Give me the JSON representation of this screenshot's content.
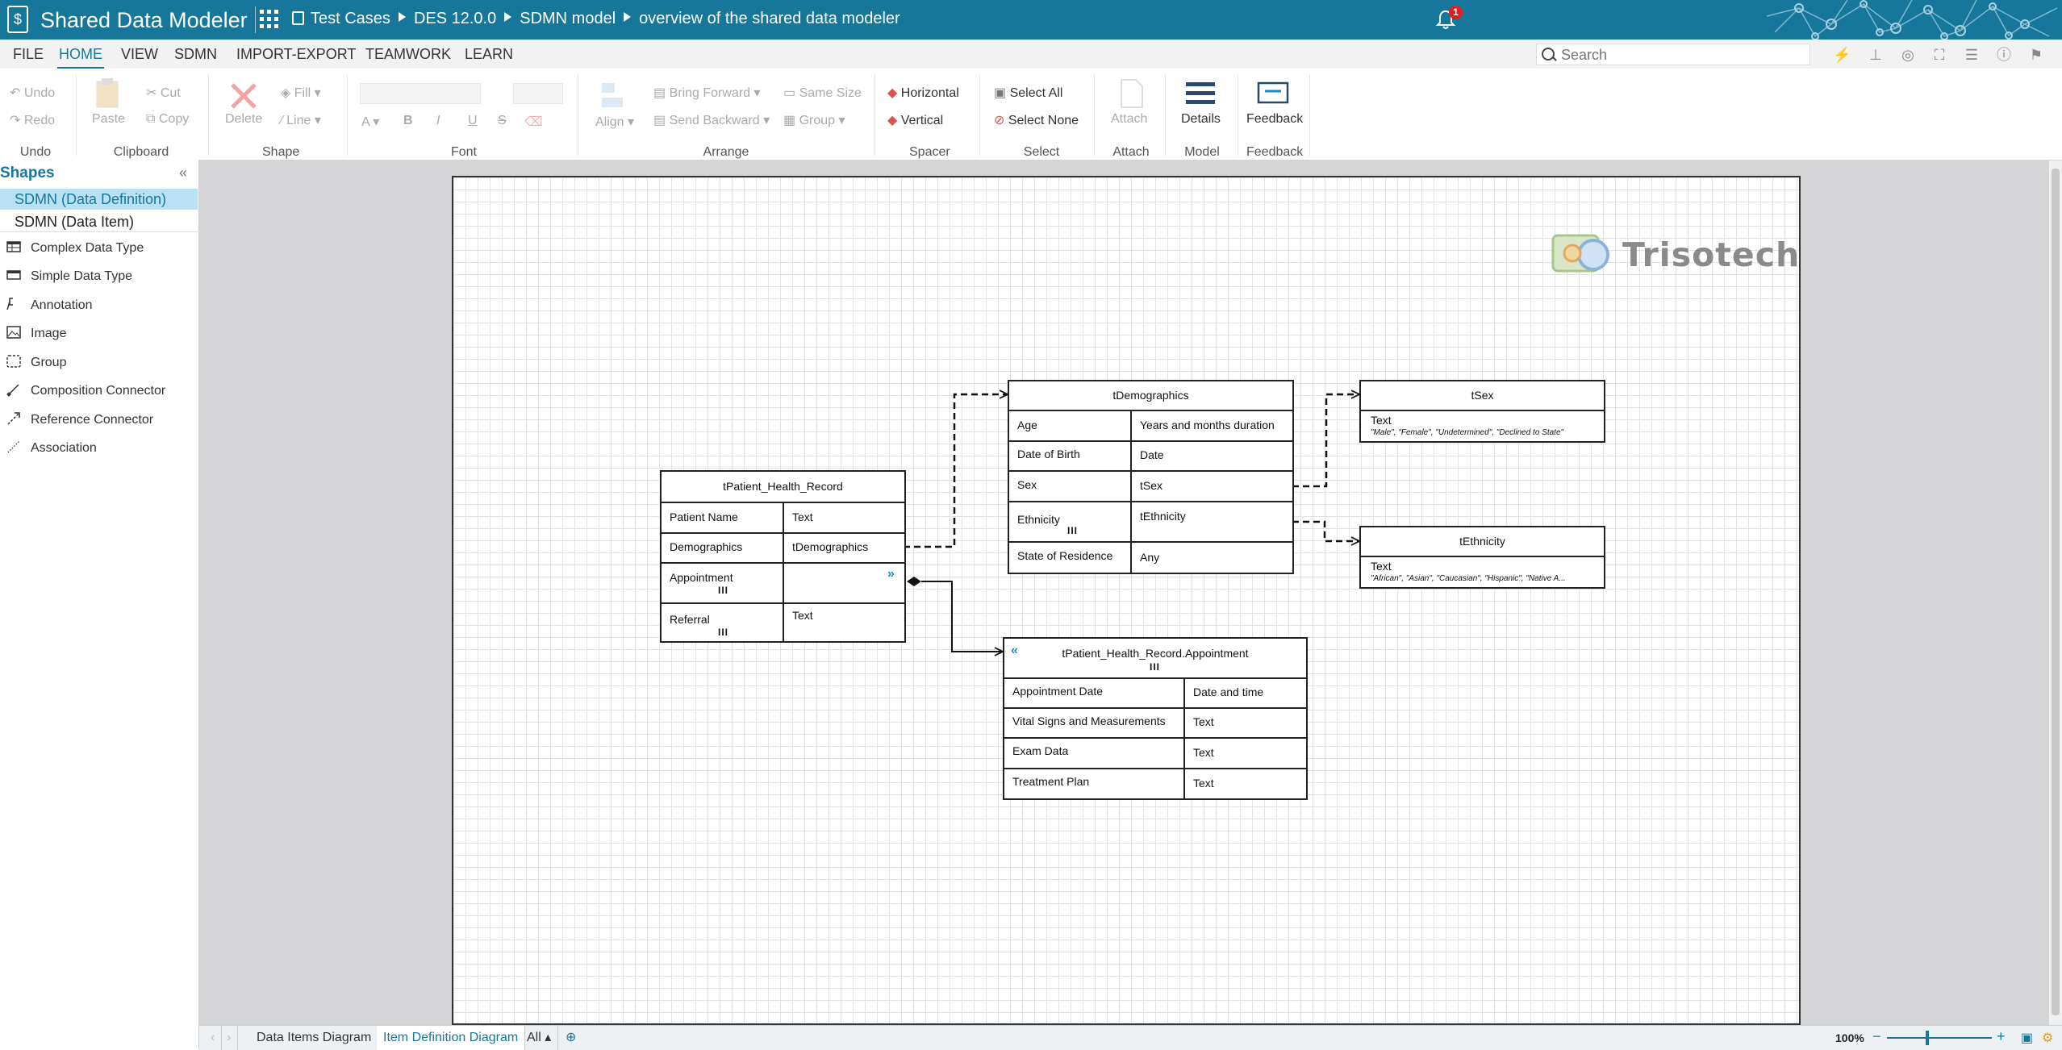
{
  "app": {
    "title": "Shared Data Modeler",
    "breadcrumbs": [
      "Test Cases",
      "DES 12.0.0",
      "SDMN model",
      "overview of the shared data modeler"
    ],
    "notification_count": "1"
  },
  "menu": {
    "items": [
      "FILE",
      "HOME",
      "VIEW",
      "SDMN",
      "IMPORT-EXPORT",
      "TEAMWORK",
      "LEARN"
    ],
    "active": "HOME"
  },
  "search": {
    "placeholder": "Search"
  },
  "ribbon": {
    "undo": "Undo",
    "redo": "Redo",
    "paste": "Paste",
    "cut": "Cut",
    "copy": "Copy",
    "delete": "Delete",
    "fill": "Fill",
    "line": "Line",
    "bold": "B",
    "italic": "I",
    "underline": "U",
    "strike": "S",
    "align": "Align",
    "bring_forward": "Bring Forward",
    "send_backward": "Send Backward",
    "same_size": "Same Size",
    "group": "Group",
    "horizontal": "Horizontal",
    "vertical": "Vertical",
    "select_all": "Select All",
    "select_none": "Select None",
    "attach": "Attach",
    "details": "Details",
    "feedback": "Feedback",
    "groups": {
      "undo": "Undo",
      "clipboard": "Clipboard",
      "shape": "Shape",
      "font": "Font",
      "arrange": "Arrange",
      "spacer": "Spacer",
      "select": "Select",
      "attach": "Attach",
      "model": "Model",
      "feedback": "Feedback"
    }
  },
  "shapes_panel": {
    "title": "Shapes",
    "collapse": "«",
    "categories": [
      "SDMN (Data Definition)",
      "SDMN (Data Item)"
    ],
    "items": [
      "Complex Data Type",
      "Simple Data Type",
      "Annotation",
      "Image",
      "Group",
      "Composition Connector",
      "Reference Connector",
      "Association"
    ]
  },
  "logo": {
    "text": "Trisotech"
  },
  "diagram": {
    "phr": {
      "title": "tPatient_Health_Record",
      "rows": [
        {
          "name": "Patient Name",
          "type": "Text"
        },
        {
          "name": "Demographics",
          "type": "tDemographics"
        },
        {
          "name": "Appointment",
          "type": ""
        },
        {
          "name": "Referral",
          "type": "Text"
        }
      ],
      "expand": "»",
      "collection": "III"
    },
    "demo": {
      "title": "tDemographics",
      "rows": [
        {
          "name": "Age",
          "type": "Years and months duration"
        },
        {
          "name": "Date of Birth",
          "type": "Date"
        },
        {
          "name": "Sex",
          "type": "tSex"
        },
        {
          "name": "Ethnicity",
          "type": "tEthnicity"
        },
        {
          "name": "State of Residence",
          "type": "Any"
        }
      ],
      "collection": "III"
    },
    "appt": {
      "title": "tPatient_Health_Record.Appointment",
      "rows": [
        {
          "name": "Appointment Date",
          "type": "Date and time"
        },
        {
          "name": "Vital Signs and Measurements",
          "type": "Text"
        },
        {
          "name": "Exam Data",
          "type": "Text"
        },
        {
          "name": "Treatment Plan",
          "type": "Text"
        }
      ],
      "collapse": "«",
      "collection": "III"
    },
    "tsex": {
      "title": "tSex",
      "type": "Text",
      "values": "\"Male\", \"Female\", \"Undetermined\", \"Declined to State\""
    },
    "teth": {
      "title": "tEthnicity",
      "type": "Text",
      "values": "\"African\", \"Asian\", \"Caucasian\", \"Hispanic\", \"Native A..."
    }
  },
  "bottom": {
    "tabs": [
      "Data Items Diagram",
      "Item Definition Diagram"
    ],
    "active_tab": "Item Definition Diagram",
    "all": "All",
    "zoom": "100%"
  },
  "colors": {
    "brand": "#16779b",
    "selection": "#b9e0f3",
    "badge": "#e02020"
  }
}
